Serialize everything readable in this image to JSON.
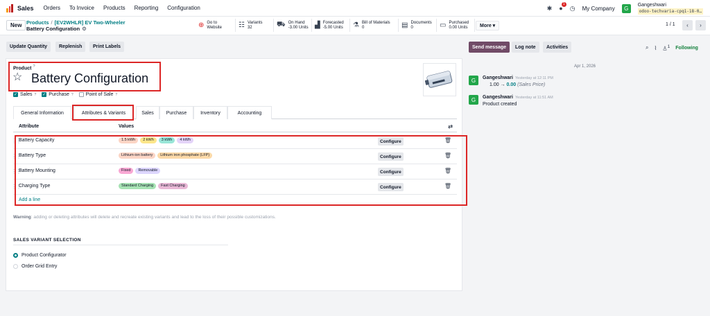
{
  "topnav": {
    "app_name": "Sales",
    "menu": [
      "Orders",
      "To Invoice",
      "Products",
      "Reporting",
      "Configuration"
    ],
    "notification_count": "1",
    "company": "My Company",
    "user_initial": "G",
    "user_name": "Gangeshwari",
    "database": "odoo-techvaria-cpq1-18-0…"
  },
  "control": {
    "new_label": "New",
    "breadcrumb": {
      "parent": "Products",
      "sep": "/",
      "grandparent": "[EV2WHLR] EV Two-Wheeler",
      "current": "Battery Configuration"
    },
    "smart_buttons": [
      {
        "icon": "globe-icon",
        "glyph": "⊕",
        "line1": "Go to",
        "line2": "Website",
        "color": "#dc2626"
      },
      {
        "icon": "variants-icon",
        "glyph": "☷",
        "line1": "Variants",
        "line2": "32",
        "color": "#374151"
      },
      {
        "icon": "on-hand-icon",
        "glyph": "⛟",
        "line1": "On Hand",
        "line2": "-3.00 Units",
        "color": "#374151"
      },
      {
        "icon": "forecast-icon",
        "glyph": "▟",
        "line1": "Forecasted",
        "line2": "-5.00 Units",
        "color": "#374151"
      },
      {
        "icon": "bom-icon",
        "glyph": "⚗",
        "line1": "Bill of Materials",
        "line2": "0",
        "color": "#374151"
      },
      {
        "icon": "documents-icon",
        "glyph": "▤",
        "line1": "Documents",
        "line2": "0",
        "color": "#374151"
      },
      {
        "icon": "purchased-icon",
        "glyph": "▭",
        "line1": "Purchased",
        "line2": "0.00 Units",
        "color": "#374151"
      }
    ],
    "more_label": "More ▾",
    "pager": "1 / 1"
  },
  "actions": [
    "Update Quantity",
    "Replenish",
    "Print Labels"
  ],
  "form": {
    "product_label": "Product",
    "product_label_sup": "?",
    "title": "Battery Configuration",
    "checkboxes": [
      {
        "label": "Sales",
        "checked": true
      },
      {
        "label": "Purchase",
        "checked": true
      },
      {
        "label": "Point of Sale",
        "checked": false
      }
    ],
    "tabs": [
      "General Information",
      "Attributes & Variants",
      "Sales",
      "Purchase",
      "Inventory",
      "Accounting"
    ],
    "table_headers": {
      "attribute": "Attribute",
      "values": "Values"
    },
    "rows": [
      {
        "name": "Battery Capacity",
        "tags": [
          {
            "label": "1.5 kWh",
            "color": "#fcd5c5"
          },
          {
            "label": "2 kWh",
            "color": "#fde68a"
          },
          {
            "label": "3 kWh",
            "color": "#99e6d8"
          },
          {
            "label": "4 kWh",
            "color": "#e4d4f9"
          }
        ]
      },
      {
        "name": "Battery Type",
        "tags": [
          {
            "label": "Lithium-ion battery",
            "color": "#fcd5c5"
          },
          {
            "label": "Lithium iron phosphate (LFP)",
            "color": "#fcd9a8"
          }
        ]
      },
      {
        "name": "Battery Mounting",
        "tags": [
          {
            "label": "Fixed",
            "color": "#f9a8d4"
          },
          {
            "label": "Removable",
            "color": "#ddd6fe"
          }
        ]
      },
      {
        "name": "Charging Type",
        "tags": [
          {
            "label": "Standard Charging",
            "color": "#a7e3b4"
          },
          {
            "label": "Fast Charging",
            "color": "#e9b8d6"
          }
        ]
      }
    ],
    "configure_label": "Configure",
    "add_line": "Add a line",
    "warning_bold": "Warning",
    "warning_text": ": adding or deleting attributes will delete and recreate existing variants and lead to the loss of their possible customizations.",
    "variant_section": "SALES VARIANT SELECTION",
    "radio_options": [
      {
        "label": "Product Configurator",
        "selected": true
      },
      {
        "label": "Order Grid Entry",
        "selected": false
      }
    ]
  },
  "chatter": {
    "send_message": "Send message",
    "log_note": "Log note",
    "activities": "Activities",
    "follower_count": "1",
    "following": "Following",
    "date": "Apr 1, 2026",
    "messages": [
      {
        "initial": "G",
        "author": "Gangeshwari",
        "time": "Yesterday at 12:11 PM",
        "old": "1.00",
        "arrow": "→",
        "new": "0.00",
        "field": "(Sales Price)"
      },
      {
        "initial": "G",
        "author": "Gangeshwari",
        "time": "Yesterday at 11:51 AM",
        "body": "Product created"
      }
    ]
  },
  "colors": {
    "accent": "#017e84",
    "primary": "#714b67",
    "highlight": "#dc2626"
  }
}
